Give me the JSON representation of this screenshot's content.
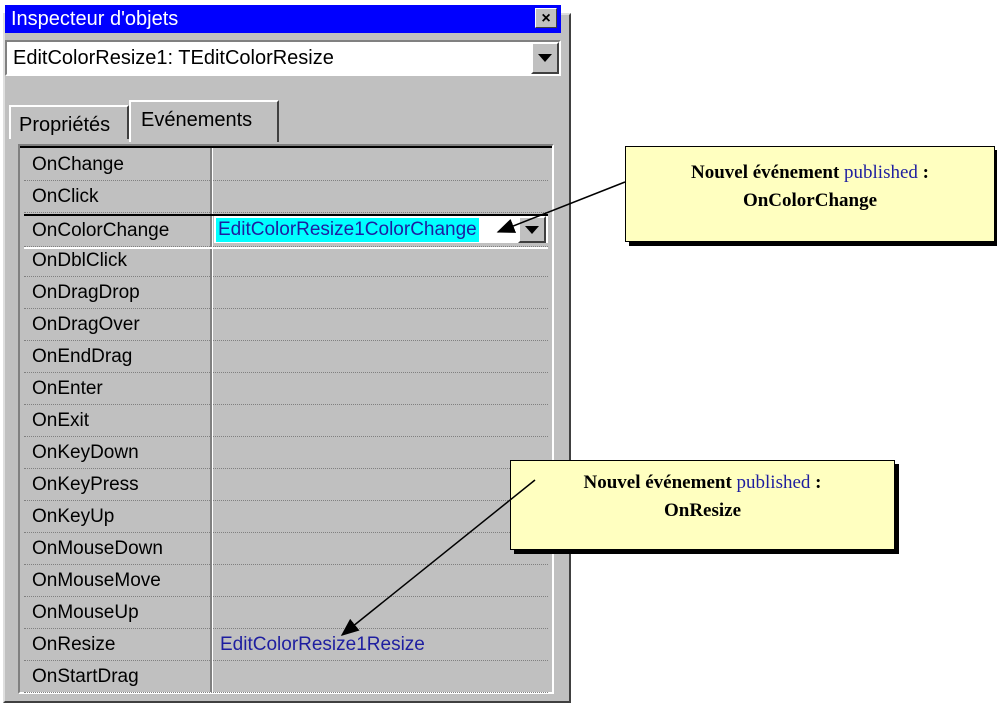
{
  "window": {
    "title": "Inspecteur d'objets",
    "close_glyph": "×",
    "object_combo": "EditColorResize1: TEditColorResize",
    "tabs": [
      {
        "label": "Propriétés",
        "active": false
      },
      {
        "label": "Evénements",
        "active": true
      }
    ]
  },
  "events": [
    {
      "name": "OnChange",
      "value": ""
    },
    {
      "name": "OnClick",
      "value": ""
    },
    {
      "name": "OnColorChange",
      "value": "EditColorResize1ColorChange",
      "selected": true
    },
    {
      "name": "OnDblClick",
      "value": ""
    },
    {
      "name": "OnDragDrop",
      "value": ""
    },
    {
      "name": "OnDragOver",
      "value": ""
    },
    {
      "name": "OnEndDrag",
      "value": ""
    },
    {
      "name": "OnEnter",
      "value": ""
    },
    {
      "name": "OnExit",
      "value": ""
    },
    {
      "name": "OnKeyDown",
      "value": ""
    },
    {
      "name": "OnKeyPress",
      "value": ""
    },
    {
      "name": "OnKeyUp",
      "value": ""
    },
    {
      "name": "OnMouseDown",
      "value": ""
    },
    {
      "name": "OnMouseMove",
      "value": ""
    },
    {
      "name": "OnMouseUp",
      "value": ""
    },
    {
      "name": "OnResize",
      "value": "EditColorResize1Resize"
    },
    {
      "name": "OnStartDrag",
      "value": ""
    }
  ],
  "callouts": [
    {
      "prefix": "Nouvel événement",
      "middle": "published",
      "suffix": ":",
      "event": "OnColorChange"
    },
    {
      "prefix": "Nouvel événement",
      "middle": "published",
      "suffix": ":",
      "event": "OnResize"
    }
  ],
  "colors": {
    "titlebar": "#0000ff",
    "selection": "#00ffff",
    "value_text": "#1e1ea0",
    "callout_bg": "#ffffc0"
  }
}
